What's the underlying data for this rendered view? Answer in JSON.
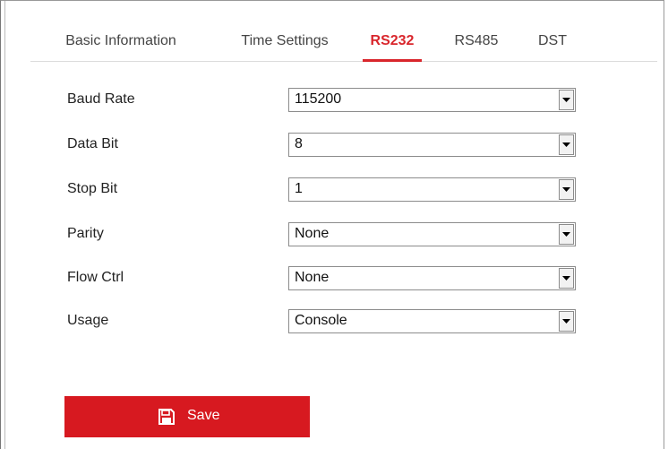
{
  "tabs": [
    {
      "label": "Basic Information",
      "active": false
    },
    {
      "label": "Time Settings",
      "active": false
    },
    {
      "label": "RS232",
      "active": true
    },
    {
      "label": "RS485",
      "active": false
    },
    {
      "label": "DST",
      "active": false
    }
  ],
  "fields": [
    {
      "label": "Baud Rate",
      "value": "115200"
    },
    {
      "label": "Data Bit",
      "value": "8"
    },
    {
      "label": "Stop Bit",
      "value": "1"
    },
    {
      "label": "Parity",
      "value": "None"
    },
    {
      "label": "Flow Ctrl",
      "value": "None"
    },
    {
      "label": "Usage",
      "value": "Console"
    }
  ],
  "save": {
    "label": "Save",
    "icon": "floppy-disk-icon"
  },
  "colors": {
    "accent": "#d71920",
    "active_tab": "#d9262c"
  }
}
